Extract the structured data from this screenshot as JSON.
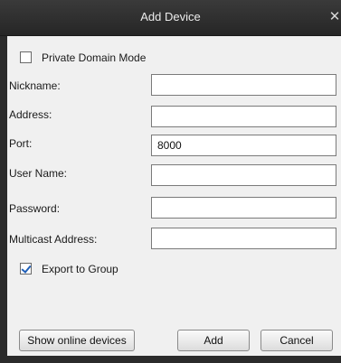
{
  "dialog": {
    "title": "Add Device",
    "close_icon": "close-icon"
  },
  "private_domain": {
    "label": "Private Domain Mode",
    "checked": false
  },
  "fields": {
    "nickname": {
      "label": "Nickname:",
      "value": ""
    },
    "address": {
      "label": "Address:",
      "value": ""
    },
    "port": {
      "label": "Port:",
      "value": "8000"
    },
    "username": {
      "label": "User Name:",
      "value": ""
    },
    "password": {
      "label": "Password:",
      "value": ""
    },
    "multicast": {
      "label": "Multicast Address:",
      "value": ""
    }
  },
  "export_group": {
    "label": "Export to Group",
    "checked": true
  },
  "buttons": {
    "show_online": "Show online devices",
    "add": "Add",
    "cancel": "Cancel"
  }
}
